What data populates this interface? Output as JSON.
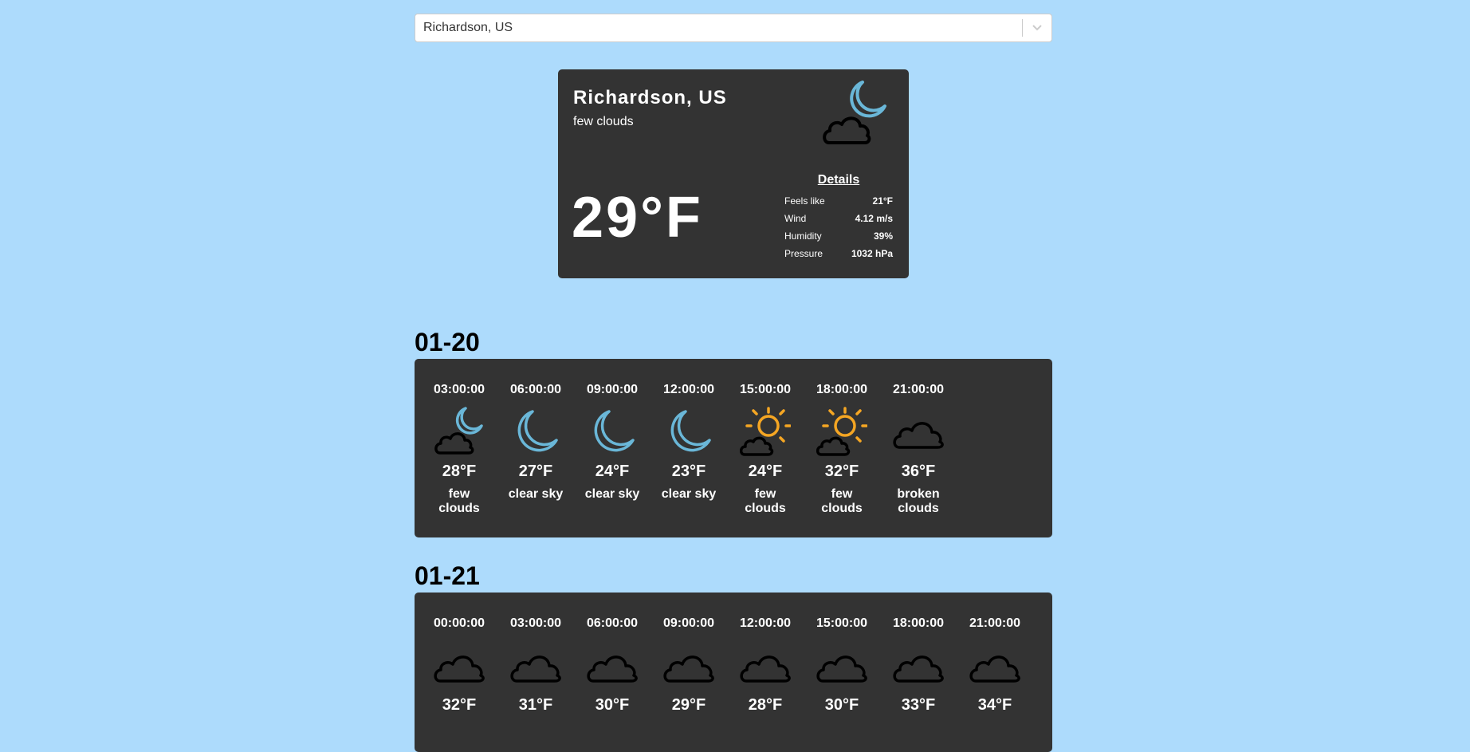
{
  "location_select": {
    "value": "Richardson, US",
    "icon": "chevron-down-icon"
  },
  "current": {
    "city": "Richardson, US",
    "description": "few clouds",
    "icon": "moon-cloud-icon",
    "temperature": "29°F",
    "details": {
      "title": "Details",
      "rows": [
        {
          "label": "Feels like",
          "value": "21°F"
        },
        {
          "label": "Wind",
          "value": "4.12 m/s"
        },
        {
          "label": "Humidity",
          "value": "39%"
        },
        {
          "label": "Pressure",
          "value": "1032 hPa"
        }
      ]
    }
  },
  "colors": {
    "background": "#addbfc",
    "card": "#333333",
    "moon": "#6ab7d8",
    "sun": "#f5a623",
    "cloud_outline": "#000000"
  },
  "days": [
    {
      "date": "01-20",
      "slots": [
        {
          "time": "03:00:00",
          "icon": "moon-cloud-icon",
          "temp": "28°F",
          "desc": "few clouds"
        },
        {
          "time": "06:00:00",
          "icon": "moon-icon",
          "temp": "27°F",
          "desc": "clear sky"
        },
        {
          "time": "09:00:00",
          "icon": "moon-icon",
          "temp": "24°F",
          "desc": "clear sky"
        },
        {
          "time": "12:00:00",
          "icon": "moon-icon",
          "temp": "23°F",
          "desc": "clear sky"
        },
        {
          "time": "15:00:00",
          "icon": "sun-cloud-icon",
          "temp": "24°F",
          "desc": "few clouds"
        },
        {
          "time": "18:00:00",
          "icon": "sun-cloud-icon",
          "temp": "32°F",
          "desc": "few clouds"
        },
        {
          "time": "21:00:00",
          "icon": "cloud-icon",
          "temp": "36°F",
          "desc": "broken clouds"
        }
      ]
    },
    {
      "date": "01-21",
      "slots": [
        {
          "time": "00:00:00",
          "icon": "cloud-icon",
          "temp": "32°F",
          "desc": ""
        },
        {
          "time": "03:00:00",
          "icon": "cloud-icon",
          "temp": "31°F",
          "desc": ""
        },
        {
          "time": "06:00:00",
          "icon": "cloud-icon",
          "temp": "30°F",
          "desc": ""
        },
        {
          "time": "09:00:00",
          "icon": "cloud-icon",
          "temp": "29°F",
          "desc": ""
        },
        {
          "time": "12:00:00",
          "icon": "cloud-icon",
          "temp": "28°F",
          "desc": ""
        },
        {
          "time": "15:00:00",
          "icon": "cloud-icon",
          "temp": "30°F",
          "desc": ""
        },
        {
          "time": "18:00:00",
          "icon": "cloud-icon",
          "temp": "33°F",
          "desc": ""
        },
        {
          "time": "21:00:00",
          "icon": "cloud-icon",
          "temp": "34°F",
          "desc": ""
        }
      ]
    }
  ]
}
